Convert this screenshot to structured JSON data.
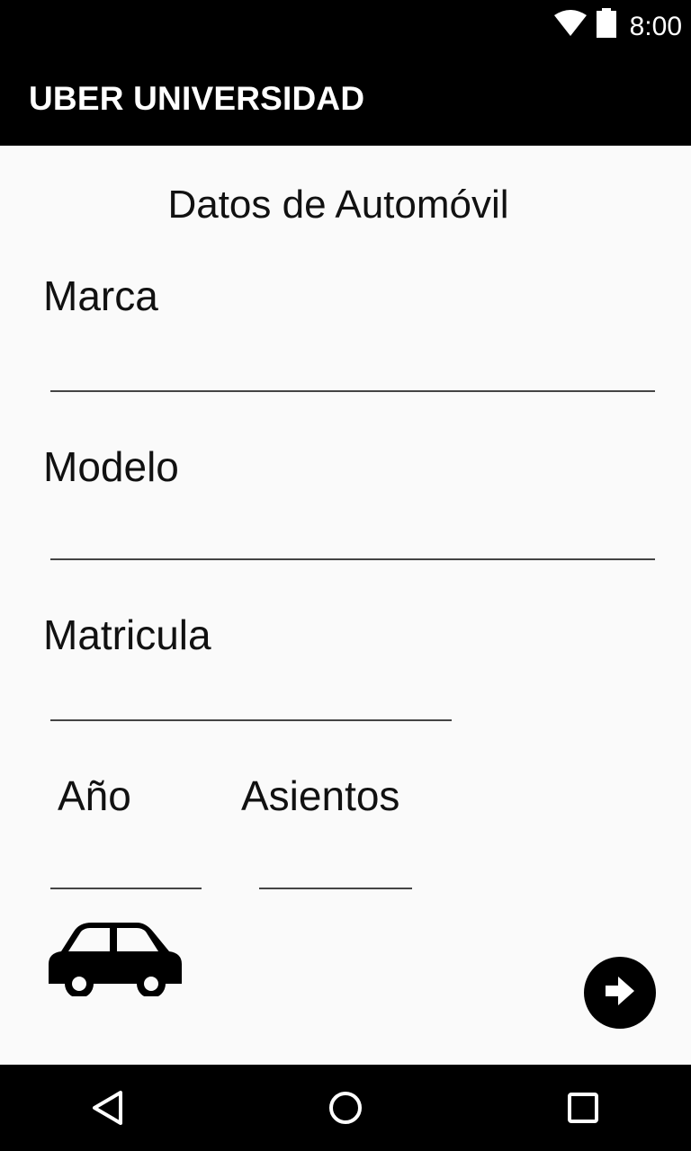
{
  "status_bar": {
    "time": "8:00",
    "wifi_icon": "wifi-icon",
    "battery_icon": "battery-icon"
  },
  "app_bar": {
    "title": "UBER UNIVERSIDAD"
  },
  "form": {
    "title": "Datos de Automóvil",
    "marca": {
      "label": "Marca",
      "value": ""
    },
    "modelo": {
      "label": "Modelo",
      "value": ""
    },
    "matricula": {
      "label": "Matricula",
      "value": ""
    },
    "anio": {
      "label": "Año",
      "value": ""
    },
    "asientos": {
      "label": "Asientos",
      "value": ""
    }
  },
  "icons": {
    "car": "car-icon",
    "next": "arrow-right-icon"
  },
  "nav_bar": {
    "back": "back-triangle-icon",
    "home": "home-circle-icon",
    "recents": "recents-square-icon"
  },
  "colors": {
    "bar_background": "#000000",
    "page_background": "#fafafa",
    "text": "#111111"
  }
}
